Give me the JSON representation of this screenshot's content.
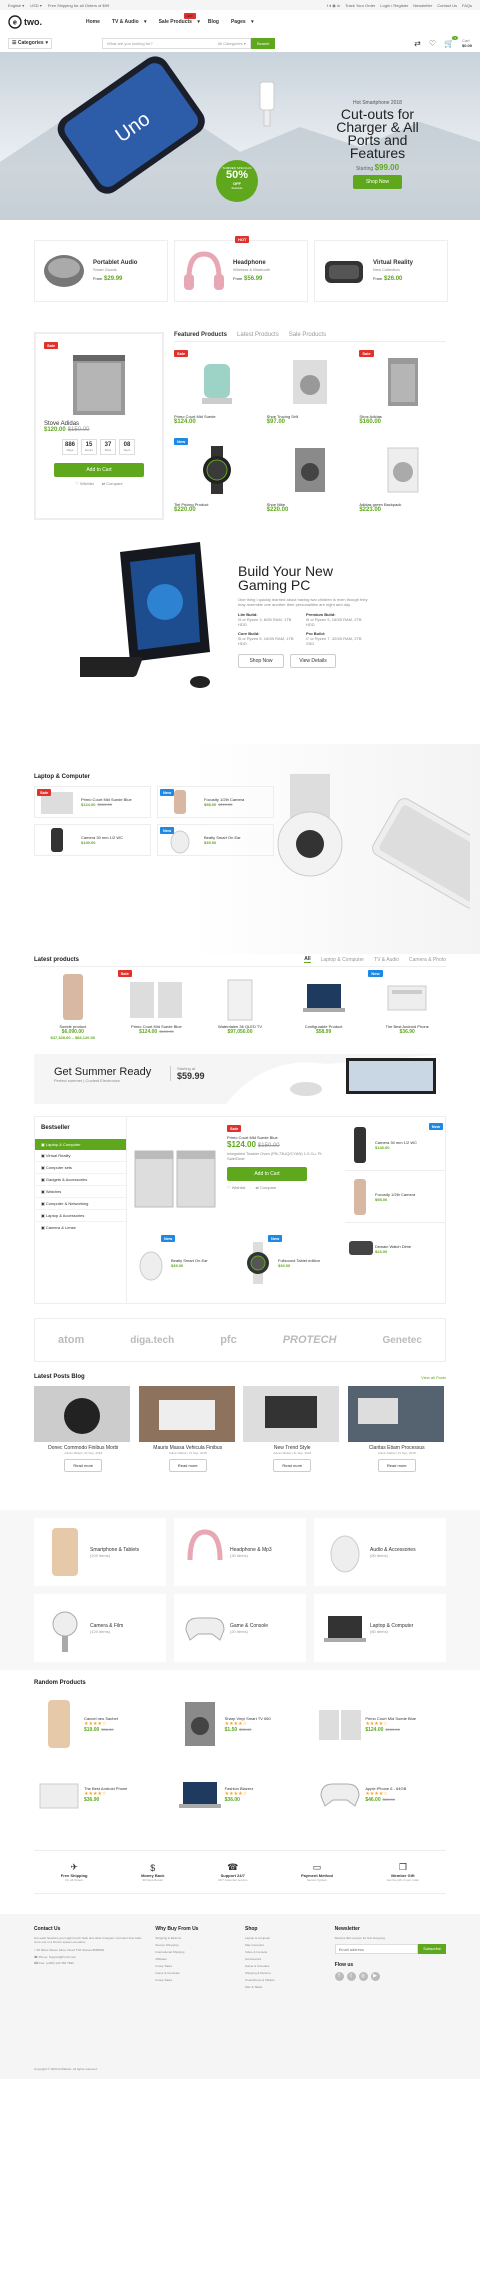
{
  "topbar": {
    "lang": "English",
    "currency": "USD",
    "shipping": "Free Shipping for all Orders of $99",
    "links": [
      "Track Your Order",
      "Login / Register",
      "Newsletter",
      "Contact Us",
      "FAQs"
    ]
  },
  "header": {
    "logo": "two.",
    "nav": [
      "Home",
      "TV & Audio",
      "Sale Products",
      "Blog",
      "Pages"
    ],
    "hot": "HOT",
    "cart_label": "Cart",
    "cart_total": "$0.00",
    "cart_count": "0"
  },
  "search": {
    "category": "Categories",
    "placeholder": "What are you looking for?",
    "all": "All Categories",
    "button": "Search"
  },
  "hero": {
    "kicker": "Hot Smartphone 2018",
    "title": "Cut-outs for Charger & All Ports and Features",
    "from": "Starting",
    "price": "99.00",
    "button": "Shop Now",
    "sale_label": "SUMMER SPECIALS",
    "sale_pct": "50%",
    "sale_off": "OFF",
    "sale_sub": "Sitewide"
  },
  "promos": [
    {
      "title": "Portablet Audio",
      "sub": "Smart Goods",
      "from": "From",
      "price": "29.99"
    },
    {
      "title": "Headphone",
      "sub": "Wireless & Bluetooth",
      "from": "From",
      "price": "56.99",
      "hot": "HOT"
    },
    {
      "title": "Virtual Reality",
      "sub": "New Collection",
      "from": "From",
      "price": "26.00"
    }
  ],
  "deal": {
    "badge": "Sale",
    "name": "Stove Adidas",
    "price": "$120.00",
    "old": "$150.00",
    "countdown": [
      {
        "v": "886",
        "l": "Days"
      },
      {
        "v": "15",
        "l": "Hours"
      },
      {
        "v": "37",
        "l": "Mins"
      },
      {
        "v": "08",
        "l": "Secs"
      }
    ],
    "button": "Add to Cart",
    "wishlist": "Wishlist",
    "compare": "Compare"
  },
  "featured": {
    "tabs": [
      "Featured Products",
      "Latest Products",
      "Sale Products"
    ],
    "items": [
      {
        "name": "Primo Court Mid Suede",
        "price": "$124.00",
        "badge": "Sale"
      },
      {
        "name": "Shoe Trucing Drill",
        "price": "$97.00",
        "badge": ""
      },
      {
        "name": "Shoe Adidas",
        "price": "$160.00",
        "badge": "Sale"
      },
      {
        "name": "Tiel Pricing Product",
        "price": "$220.00",
        "badge": "New"
      },
      {
        "name": "Shoe Nike",
        "price": "$220.00",
        "badge": ""
      },
      {
        "name": "Adidas green Backpack",
        "price": "$223.00",
        "badge": ""
      }
    ]
  },
  "gaming": {
    "title": "Build Your New Gaming PC",
    "desc": "One thing I quickly learned about having two children is even though they may resemble one another their personalities are night and day.",
    "specs": [
      {
        "k": "Lite Build:",
        "v": "i3 or Ryzen 3, 8GB RAM, 1TB HDD"
      },
      {
        "k": "Premium Build:",
        "v": "i5 or Ryzen 5, 16GB RAM, 2TB HDD"
      },
      {
        "k": "Core Build:",
        "v": "i5 or Ryzen 5, 16GB RAM, 1TB HDD"
      },
      {
        "k": "Pro Build:",
        "v": "i7 or Ryzen 7, 32GB RAM, 2TB SSD"
      }
    ],
    "buttons": [
      "Shop Now",
      "View Details"
    ]
  },
  "laptop": {
    "title": "Laptop & Computer",
    "items": [
      {
        "name": "Primo Court Mid Suede Blue",
        "price": "$124.00",
        "old": "$150.00",
        "badge": "Sale"
      },
      {
        "name": "Focusity 1/2th Camera",
        "price": "$98.00",
        "old": "$110.00",
        "badge": "New"
      },
      {
        "name": "Camera 30 mm 1/2 WC",
        "price": "$140.00",
        "old": "",
        "badge": ""
      },
      {
        "name": "Beatly Smart On Ear",
        "price": "$39.00",
        "old": "",
        "badge": "New"
      }
    ]
  },
  "latest": {
    "title": "Latest products",
    "tabs": [
      "All",
      "Laptop & Computer",
      "TV & Audio",
      "Camera & Photo"
    ],
    "items": [
      {
        "name": "Sueide product",
        "price": "$6,090.00",
        "range": "$47,328.00 – $66,120.00",
        "badge": ""
      },
      {
        "name": "Primo Court Mid Suede Blue",
        "price": "$124.00",
        "old": "$150.00",
        "badge": "Sale"
      },
      {
        "name": "Waterdalen 36 QLED TV",
        "price": "$97,050.00",
        "old": "",
        "badge": ""
      },
      {
        "name": "Configurable Product",
        "price": "$58.99",
        "old": "",
        "badge": ""
      },
      {
        "name": "The Best Android Phone",
        "price": "$36.90",
        "old": "",
        "badge": "New"
      }
    ]
  },
  "summer": {
    "title": "Get Summer Ready",
    "sub": "Perfect summer | Coolest Electronics",
    "starting": "Starting at",
    "price": "59.99"
  },
  "bestseller": {
    "title": "Bestseller",
    "cats": [
      "Laptop & Computer",
      "Virtual Reality",
      "Computer sets",
      "Gadgets & Accessories",
      "Watches",
      "Computer & Networking",
      "Laptop & Accessories",
      "Camera & Lense"
    ],
    "main": {
      "badge": "Sale",
      "name": "Primo Court Mid Suede Blue",
      "price": "$124.00",
      "old": "$150.00",
      "desc": "Integrated Toaster Oven (PB-73UQ/CYAN) 1.9 Cu. Ft.",
      "desc2": "Sale/Deal ",
      "button": "Add to Cart",
      "wishlist": "Wishlist",
      "compare": "Compare"
    },
    "side": [
      {
        "name": "Camera 30 mm 1/2 WC",
        "price": "$140.00",
        "badge": "New"
      },
      {
        "name": "Focusity 1/2th Camera",
        "price": "$98.00",
        "badge": ""
      },
      {
        "name": "Beatly Smart On Ear",
        "price": "$39.00",
        "badge": "New"
      },
      {
        "name": "Fullsound Tablet edition",
        "price": "$30.00",
        "badge": "New"
      },
      {
        "name": "Dewain Watch Dime",
        "price": "$23.00",
        "badge": ""
      }
    ]
  },
  "brands": [
    "atom",
    "diga.tech",
    "pfc",
    "PROTECH",
    "Genetec"
  ],
  "blog": {
    "title": "Latest Posts Blog",
    "viewall": "View all Posts",
    "posts": [
      {
        "title": "Donec Commodo Finibus Morbi",
        "meta": "Admin Mabel  |  31 Sep, 2018"
      },
      {
        "title": "Mauris Massa Vehicula Finibus",
        "meta": "Admin Mabel  |  31 Sep, 2018"
      },
      {
        "title": "New Trend Style",
        "meta": "Admin Mabel  |  31 Sep, 2018"
      },
      {
        "title": "Claritas Etiam Processus",
        "meta": "Admin Mabel  |  31 Sep, 2018"
      }
    ],
    "more": "Read more"
  },
  "cats": [
    {
      "name": "Smartphone & Tablets",
      "count": "(100 items)"
    },
    {
      "name": "Headphone & Mp3",
      "count": "(30 items)"
    },
    {
      "name": "Audio & Accessories",
      "count": "(50 items)"
    },
    {
      "name": "Camera & Film",
      "count": "(120 items)"
    },
    {
      "name": "Game & Console",
      "count": "(20 items)"
    },
    {
      "name": "Laptop & Computer",
      "count": "(80 items)"
    }
  ],
  "random": {
    "title": "Random Products",
    "items": [
      {
        "name": "Cancel neo Sachet",
        "price": "$19.00",
        "old": "$56.00"
      },
      {
        "name": "Sharp Vinyl Smart TV 650",
        "price": "$1.50",
        "old": "$35.00"
      },
      {
        "name": "Primo Court Mid Suede Blue",
        "price": "$124.00",
        "old": "$150.00"
      },
      {
        "name": "The Best Android Phone",
        "price": "$36.90",
        "old": ""
      },
      {
        "name": "Fashion Blazerz",
        "price": "$36.00",
        "old": ""
      },
      {
        "name": "Apple iPhone 6 - 64GB",
        "price": "$46.00",
        "old": "$55.00"
      }
    ]
  },
  "features": [
    {
      "t": "Free Shipping",
      "s": "On all Orders"
    },
    {
      "t": "Money Back",
      "s": "30 Days Return"
    },
    {
      "t": "Support 24/7",
      "s": "24/7 customer service"
    },
    {
      "t": "Payment Method",
      "s": "Secure System"
    },
    {
      "t": "Member Gift",
      "s": "Get the gift of your order"
    }
  ],
  "footer": {
    "contact_title": "Contact Us",
    "contact_text": "Got each favorites yumi sight touch hello and other foreigner of protect Vine hello once one in a thrown space Live-alone",
    "address": "50 Ribne Street, Mme Ciuvel TSF Stanoa 8080892",
    "phone": "Phone: Support@Forth.com",
    "fax": "Fax: (+084) 123 456 7890",
    "cols": [
      {
        "title": "Why Buy From Us",
        "links": [
          "Shipping & Returns",
          "Secure Shopping",
          "International Shipping",
          "Affiliates",
          "Group Sales",
          "Game & Consoles",
          "Group Sales"
        ]
      },
      {
        "title": "Shop",
        "links": [
          "Laptop & computer",
          "Mac computer",
          "Video & Console",
          "Accessories",
          "Game & Consoles",
          "Shipping & Returns",
          "Smartphone & Tablets",
          "Mac & Tablet"
        ]
      }
    ],
    "news_title": "Newsletter",
    "news_text": "Receive $10 coupon for first shopping",
    "news_placeholder": "Email address",
    "news_button": "Subscribe",
    "follow": "Flow us",
    "copyright": "Copyright © 2020 ArrMarker. All rights reserved."
  }
}
